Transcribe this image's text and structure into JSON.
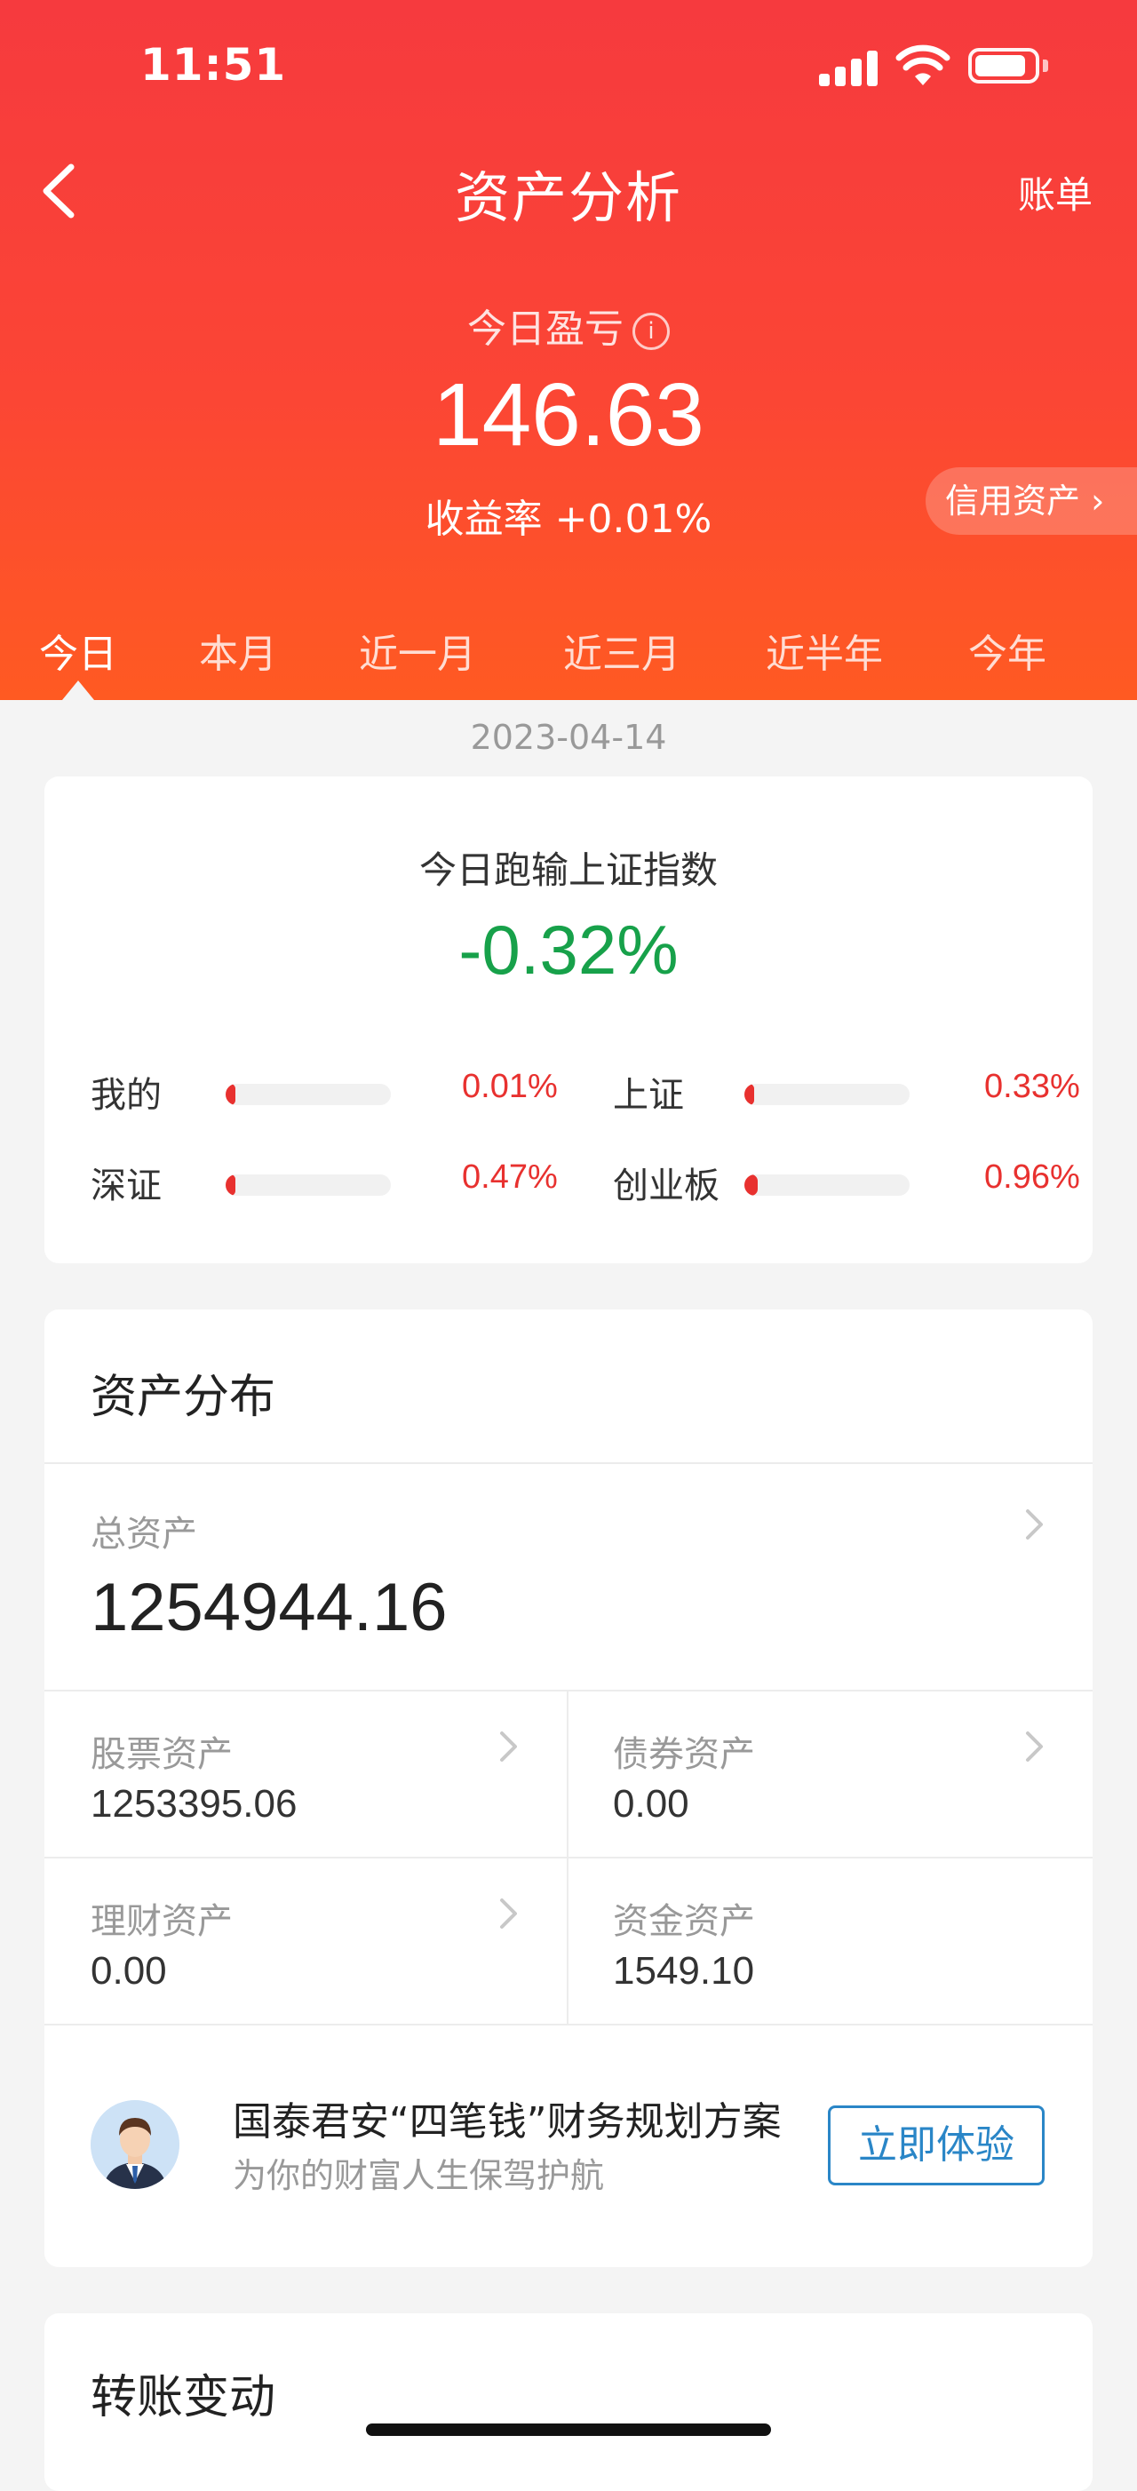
{
  "status_bar": {
    "time": "11:51"
  },
  "nav": {
    "title": "资产分析",
    "bill": "账单"
  },
  "pnl": {
    "label": "今日盈亏",
    "info_glyph": "i",
    "value": "146.63",
    "rate": "收益率 +0.01%"
  },
  "credit_assets": {
    "label": "信用资产 ›"
  },
  "tabs": [
    {
      "label": "今日",
      "active": true
    },
    {
      "label": "本月"
    },
    {
      "label": "近一月"
    },
    {
      "label": "近三月"
    },
    {
      "label": "近半年"
    },
    {
      "label": "今年"
    }
  ],
  "date": "2023-04-14",
  "comparison": {
    "title": "今日跑输上证指数",
    "value": "-0.32%",
    "items": [
      {
        "label": "我的",
        "value": "0.01%",
        "fill": 0.01
      },
      {
        "label": "上证",
        "value": "0.33%",
        "fill": 0.03
      },
      {
        "label": "深证",
        "value": "0.47%",
        "fill": 0.04
      },
      {
        "label": "创业板",
        "value": "0.96%",
        "fill": 0.08
      }
    ]
  },
  "distribution": {
    "title": "资产分布",
    "total_label": "总资产",
    "total_value": "1254944.16",
    "stock_label": "股票资产",
    "stock_value": "1253395.06",
    "bond_label": "债券资产",
    "bond_value": "0.00",
    "finance_label": "理财资产",
    "finance_value": "0.00",
    "cash_label": "资金资产",
    "cash_value": "1549.10"
  },
  "promo": {
    "title": "国泰君安“四笔钱”财务规划方案",
    "subtitle": "为你的财富人生保驾护航",
    "button": "立即体验"
  },
  "transfer": {
    "title": "转账变动"
  },
  "colors": {
    "header_red": "#f63a3e",
    "loss_green": "#17a14a",
    "gain_red": "#e8312f",
    "link_blue": "#2a86c7"
  }
}
